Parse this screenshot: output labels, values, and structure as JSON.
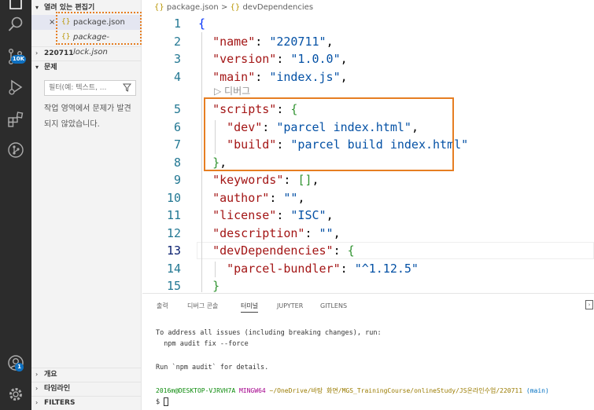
{
  "sidebar": {
    "open_editors_title": "열려 있는 편집기",
    "close_glyph": "×",
    "file_icon": "{}",
    "open_editors": [
      {
        "name": "package.json"
      },
      {
        "name": "package-lock.json"
      }
    ],
    "folder_title": "220711",
    "problems_title": "문제",
    "filter_placeholder": "필터(예: 텍스트, ...",
    "problems_message": "작업 영역에서 문제가 발견되지 않았습니다.",
    "outline_title": "개요",
    "timeline_title": "타임라인",
    "filters_title": "FILTERS"
  },
  "activity_bar": {
    "scm_badge": "10K",
    "accounts_badge": "1",
    "icons": [
      "explorer-icon",
      "search-icon",
      "source-control-icon",
      "run-debug-icon",
      "extensions-icon",
      "git-graph-icon",
      "accounts-icon",
      "settings-gear-icon"
    ]
  },
  "breadcrumb": {
    "file_icon": "{}",
    "file": "package.json",
    "sep": ">",
    "item_icon": "{}",
    "item": "devDependencies"
  },
  "editor": {
    "line_numbers": [
      "1",
      "2",
      "3",
      "4",
      "5",
      "6",
      "7",
      "8",
      "9",
      "10",
      "11",
      "12",
      "13",
      "14",
      "15"
    ],
    "active_line": "13",
    "code_lens": "▷ 디버그",
    "lines": [
      [
        [
          "b1",
          "{"
        ]
      ],
      [
        [
          "p",
          "  "
        ],
        [
          "k",
          "\"name\""
        ],
        [
          "p",
          ": "
        ],
        [
          "s",
          "\"220711\""
        ],
        [
          "p",
          ","
        ]
      ],
      [
        [
          "p",
          "  "
        ],
        [
          "k",
          "\"version\""
        ],
        [
          "p",
          ": "
        ],
        [
          "s",
          "\"1.0.0\""
        ],
        [
          "p",
          ","
        ]
      ],
      [
        [
          "p",
          "  "
        ],
        [
          "k",
          "\"main\""
        ],
        [
          "p",
          ": "
        ],
        [
          "s",
          "\"index.js\""
        ],
        [
          "p",
          ","
        ]
      ],
      [
        [
          "p",
          "  "
        ],
        [
          "k",
          "\"scripts\""
        ],
        [
          "p",
          ": "
        ],
        [
          "b2",
          "{"
        ]
      ],
      [
        [
          "p",
          "    "
        ],
        [
          "k",
          "\"dev\""
        ],
        [
          "p",
          ": "
        ],
        [
          "s",
          "\"parcel index.html\""
        ],
        [
          "p",
          ","
        ]
      ],
      [
        [
          "p",
          "    "
        ],
        [
          "k",
          "\"build\""
        ],
        [
          "p",
          ": "
        ],
        [
          "s",
          "\"parcel build index.html\""
        ]
      ],
      [
        [
          "p",
          "  "
        ],
        [
          "b2",
          "}"
        ],
        [
          "p",
          ","
        ]
      ],
      [
        [
          "p",
          "  "
        ],
        [
          "k",
          "\"keywords\""
        ],
        [
          "p",
          ": "
        ],
        [
          "b2",
          "[]"
        ],
        [
          "p",
          ","
        ]
      ],
      [
        [
          "p",
          "  "
        ],
        [
          "k",
          "\"author\""
        ],
        [
          "p",
          ": "
        ],
        [
          "s",
          "\"\""
        ],
        [
          "p",
          ","
        ]
      ],
      [
        [
          "p",
          "  "
        ],
        [
          "k",
          "\"license\""
        ],
        [
          "p",
          ": "
        ],
        [
          "s",
          "\"ISC\""
        ],
        [
          "p",
          ","
        ]
      ],
      [
        [
          "p",
          "  "
        ],
        [
          "k",
          "\"description\""
        ],
        [
          "p",
          ": "
        ],
        [
          "s",
          "\"\""
        ],
        [
          "p",
          ","
        ]
      ],
      [
        [
          "p",
          "  "
        ],
        [
          "k",
          "\"devDependencies\""
        ],
        [
          "p",
          ": "
        ],
        [
          "b2",
          "{"
        ]
      ],
      [
        [
          "p",
          "    "
        ],
        [
          "k",
          "\"parcel-bundler\""
        ],
        [
          "p",
          ": "
        ],
        [
          "s",
          "\"^1.12.5\""
        ]
      ],
      [
        [
          "p",
          "  "
        ],
        [
          "b2",
          "}"
        ]
      ]
    ]
  },
  "panel": {
    "tabs": [
      {
        "label": "출력"
      },
      {
        "label": "디버그 콘솔"
      },
      {
        "label": "터미널"
      },
      {
        "label": "JUPYTER"
      },
      {
        "label": "GITLENS"
      }
    ],
    "active_tab": "터미널",
    "maximize_glyph": "›",
    "terminal": {
      "line1": "To address all issues (including breaking changes), run:",
      "line2": "  npm audit fix --force",
      "line3": "Run `npm audit` for details.",
      "prompt_user": "2016m@DESKTOP-VJRVH7A",
      "prompt_shell": "MINGW64",
      "prompt_path": "~/OneDrive/바탕 화면/MGS_TrainingCourse/onlineStudy/JS온라인수업/220711",
      "prompt_branch": "(main)",
      "prompt_symbol": "$"
    }
  },
  "colors": {
    "highlight_box": "#e67e22",
    "activity_bg": "#2c2c2c",
    "badge": "#0e70c0"
  }
}
